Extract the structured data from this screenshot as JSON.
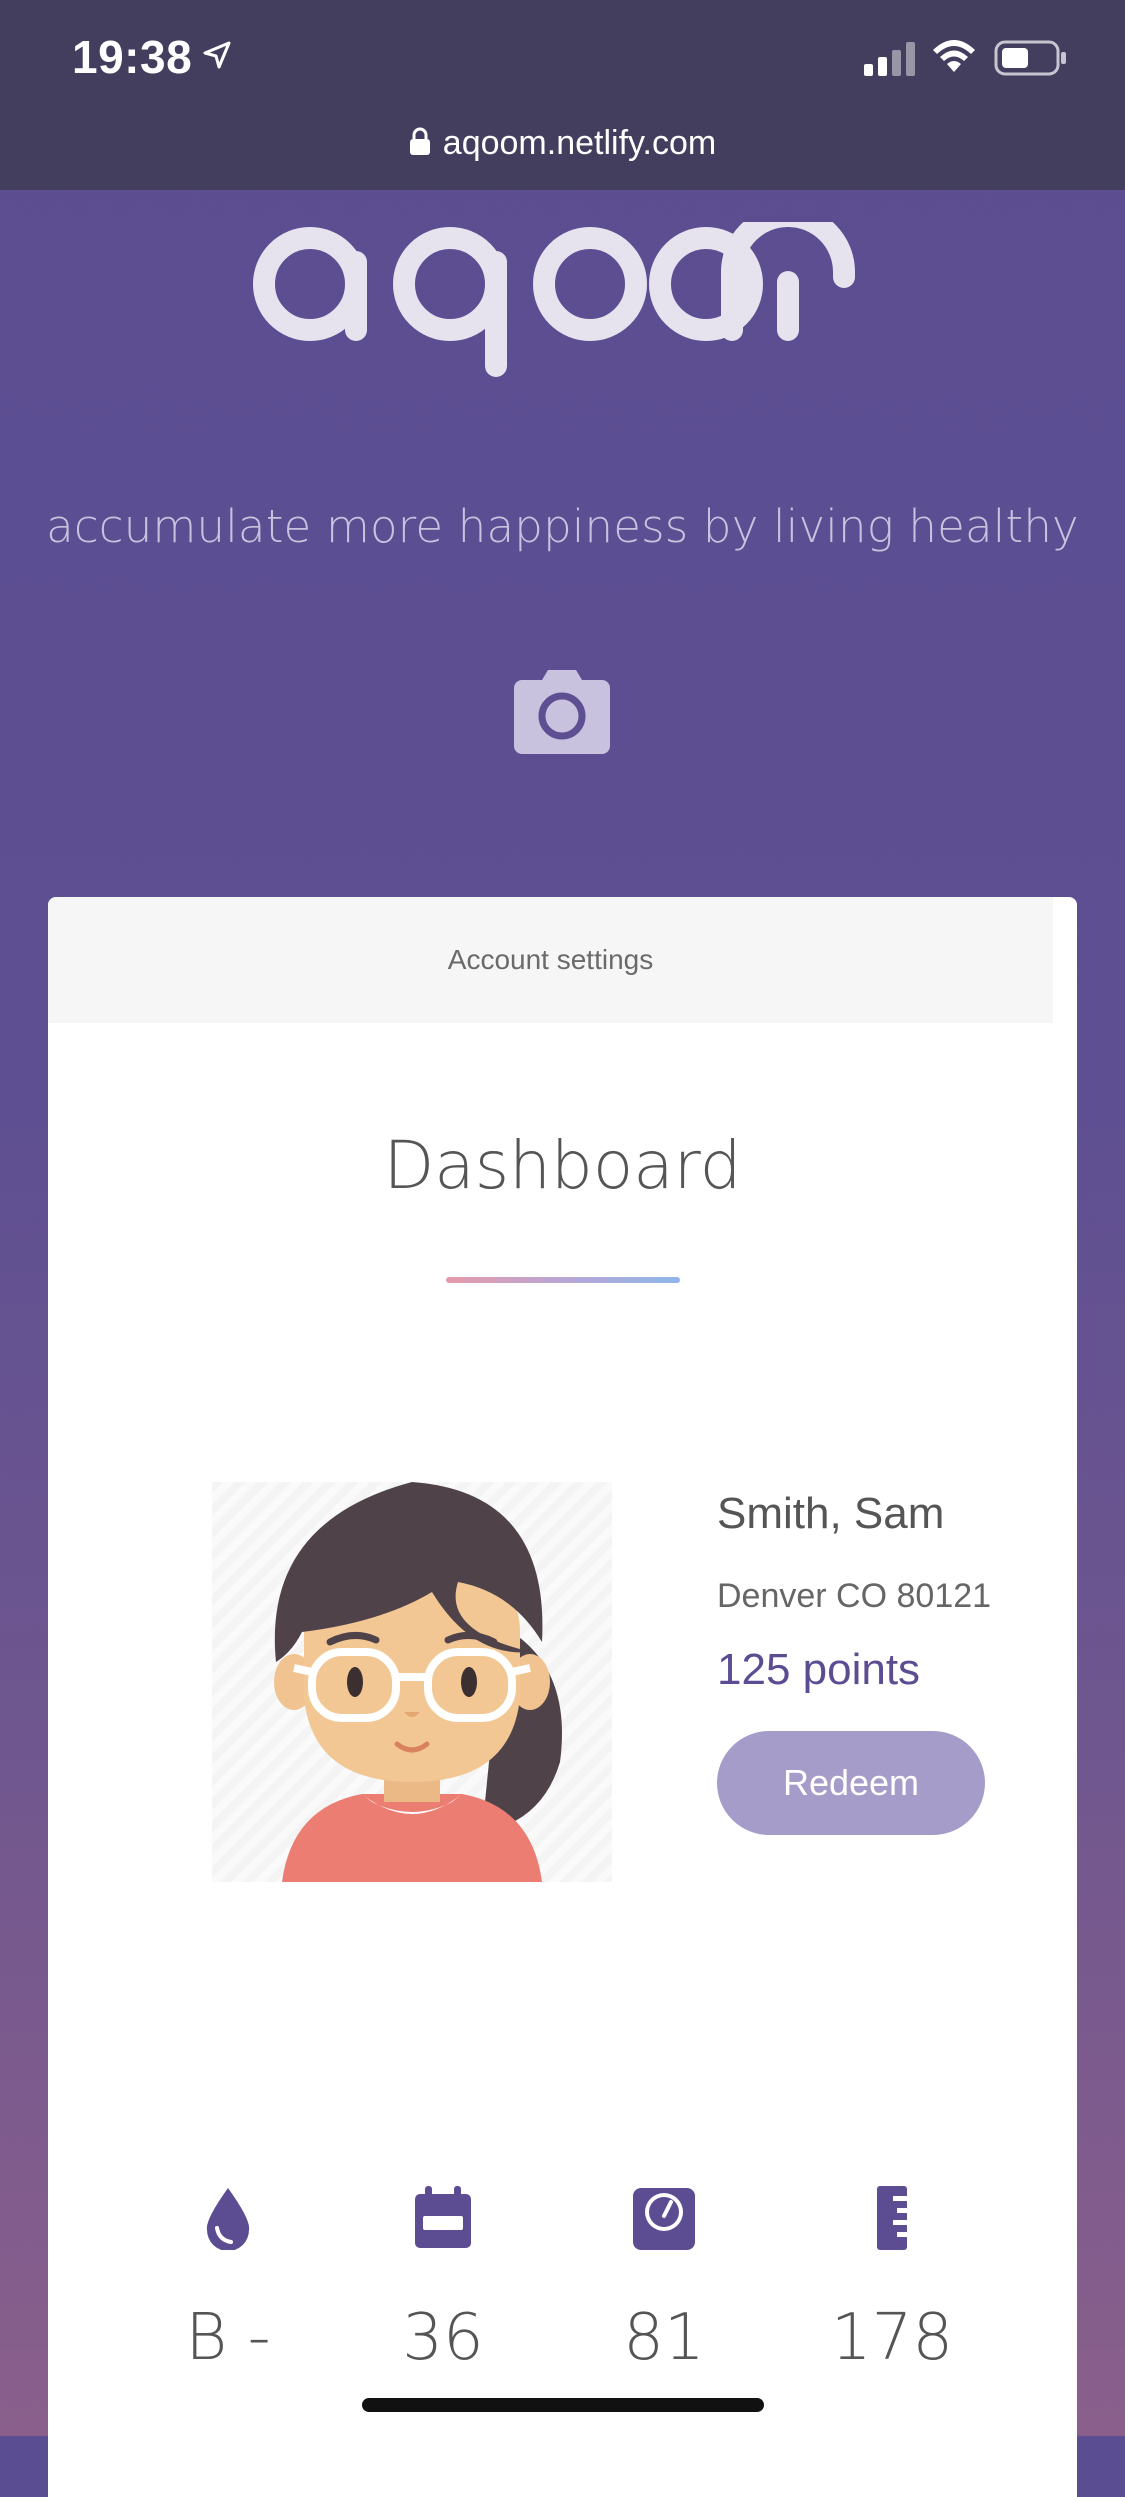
{
  "status_bar": {
    "time": "19:38"
  },
  "browser": {
    "url": "aqoom.netlify.com"
  },
  "hero": {
    "logo_text": "aqoom",
    "tagline": "accumulate more happiness by living healthy"
  },
  "card": {
    "settings_label": "Account settings",
    "title": "Dashboard",
    "profile": {
      "name": "Smith, Sam",
      "location": "Denver CO 80121",
      "points": "125 points",
      "redeem_label": "Redeem"
    },
    "stats": [
      {
        "icon": "blood-drop-icon",
        "value": "B -"
      },
      {
        "icon": "calendar-icon",
        "value": "36"
      },
      {
        "icon": "scale-icon",
        "value": "81"
      },
      {
        "icon": "ruler-icon",
        "value": "178"
      }
    ]
  },
  "colors": {
    "brand_purple": "#5c4d92",
    "button_purple": "#a59cc9",
    "header_dark": "#443e5e"
  }
}
